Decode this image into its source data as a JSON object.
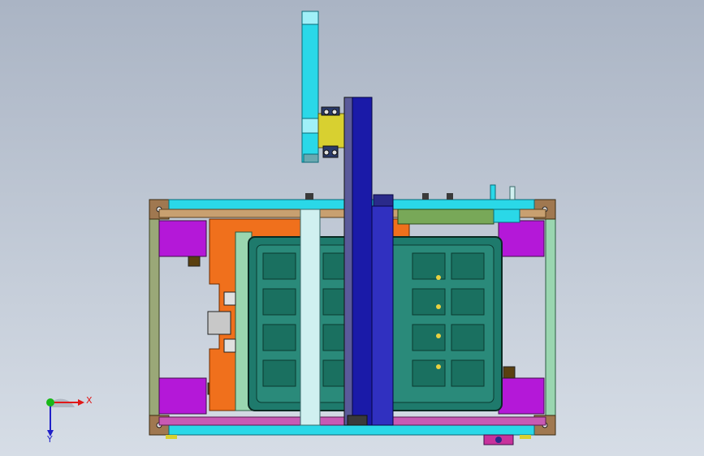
{
  "viewport": {
    "background_top": "#aab4c4",
    "background_bottom": "#d6dde6"
  },
  "triad": {
    "x_label": "X",
    "y_label": "Y",
    "x_color": "#e01818",
    "y_color": "#2020c8",
    "z_color": "#18b818"
  },
  "colors": {
    "cyan": "#2ad8e8",
    "purple": "#b418d8",
    "orange": "#f0701c",
    "teal": "#1e7a6c",
    "navy": "#1a1aa8",
    "olive_frame": "#9aa878",
    "yellow_block": "#d8d030",
    "light_blue": "#98e0e0",
    "brown": "#a07850",
    "green_frame": "#78a858",
    "magenta": "#c8329c",
    "light_green": "#9ad6b0"
  }
}
